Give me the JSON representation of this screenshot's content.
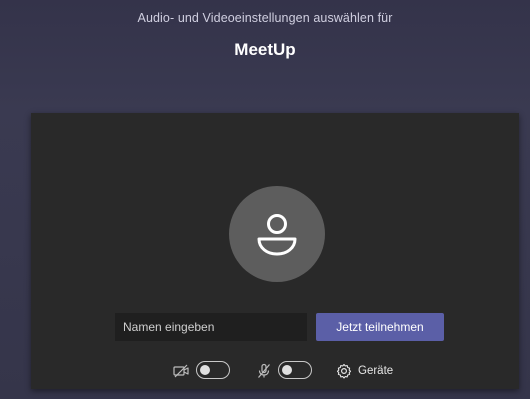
{
  "header": {
    "subtitle": "Audio- und Videoeinstellungen auswählen für",
    "meeting_title": "MeetUp"
  },
  "prejoin": {
    "avatar_icon": "person-icon",
    "name_field": {
      "placeholder": "Namen eingeben",
      "value": ""
    },
    "join_label": "Jetzt teilnehmen",
    "camera": {
      "icon": "camera-off-icon",
      "enabled": false
    },
    "microphone": {
      "icon": "mic-off-icon",
      "enabled": false
    },
    "devices": {
      "icon": "gear-icon",
      "label": "Geräte"
    }
  },
  "colors": {
    "background": "#3a3a51",
    "panel": "#292929",
    "accent": "#5b5fa7",
    "avatar": "#5d5d5d"
  }
}
